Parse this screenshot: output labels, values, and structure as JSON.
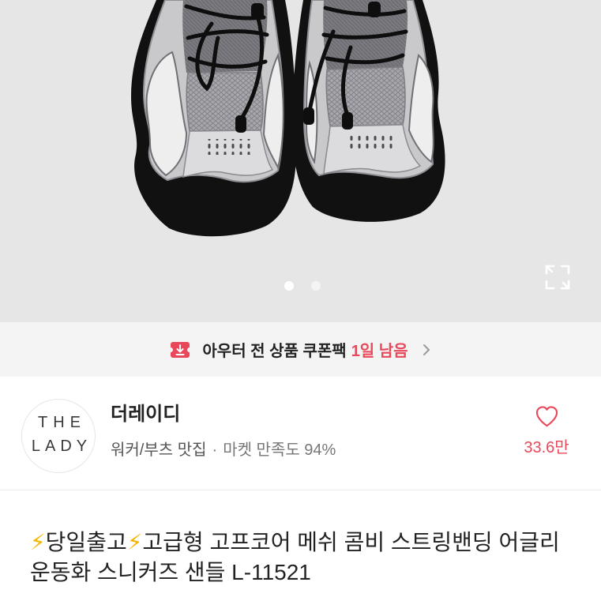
{
  "product_image": {
    "carousel": {
      "total": 2,
      "active": 1
    },
    "expand_icon": "expand-icon"
  },
  "coupon_banner": {
    "icon": "coupon-download-icon",
    "text": "아우터 전 상품 쿠폰팩",
    "highlight": "1일 남음",
    "chevron_icon": "chevron-right-icon"
  },
  "store": {
    "logo": {
      "line1": "THE",
      "line2": "LADY"
    },
    "name": "더레이디",
    "tag": "워커/부츠 맛집",
    "separator": "·",
    "satisfaction": "마켓 만족도 94%",
    "like_icon": "heart-outline-icon",
    "like_count": "33.6만"
  },
  "product": {
    "title": "⚡당일출고⚡고급형 고프코어 메쉬 콤비 스트링밴딩 어글리 운동화 스니커즈 샌들 L-11521"
  },
  "colors": {
    "accent": "#e9485b",
    "image_background": "#e6e6e7",
    "banner_background": "#f4f4f4"
  }
}
